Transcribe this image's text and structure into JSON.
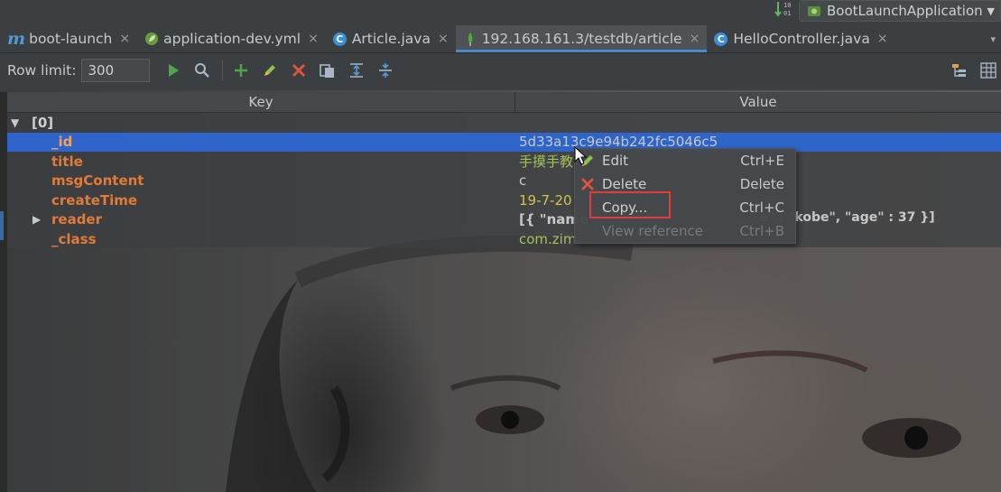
{
  "run_config": {
    "label": "BootLaunchApplication",
    "caret": "▼",
    "sort_badge": "10\n01"
  },
  "tabs": [
    {
      "label": "boot-launch",
      "icon": "maven-m-icon",
      "glyph": "m",
      "close": "×"
    },
    {
      "label": "application-dev.yml",
      "icon": "spring-leaf-icon",
      "close": "×"
    },
    {
      "label": "Article.java",
      "icon": "class-c-icon",
      "glyph": "C",
      "close": "×"
    },
    {
      "label": "192.168.161.3/testdb/article",
      "icon": "mongo-leaf-icon",
      "close": "×",
      "active": true
    },
    {
      "label": "HelloController.java",
      "icon": "class-c-icon",
      "glyph": "C",
      "close": "×"
    }
  ],
  "tab_overflow": "▾",
  "toolbar": {
    "row_limit_label": "Row limit:",
    "row_limit_value": "300",
    "buttons": [
      "run-icon",
      "find-icon",
      "add-icon",
      "edit-icon",
      "delete-icon",
      "copy-icon",
      "expand-all-icon",
      "collapse-all-icon"
    ],
    "right_buttons": [
      "tree-view-icon",
      "table-view-icon"
    ]
  },
  "table": {
    "headers": {
      "key": "Key",
      "value": "Value"
    },
    "root": {
      "expander": "▼",
      "label": "[0]"
    },
    "rows": [
      {
        "key": "_id",
        "value": "5d33a13c9e94b242fc5046c5",
        "type": "plain",
        "selected": true
      },
      {
        "key": "title",
        "value": "手摸手教",
        "type": "str"
      },
      {
        "key": "msgContent",
        "value": "c",
        "type": "plain"
      },
      {
        "key": "createTime",
        "value": "19-7-20",
        "type": "num"
      },
      {
        "key": "reader",
        "value": "[{ \"name",
        "type": "plain",
        "expander": "▶",
        "bold": true
      },
      {
        "key": "_class",
        "value": "com.zim",
        "type": "str"
      }
    ],
    "reader_tail": "e\" : \"kobe\", \"age\" : 37 }]"
  },
  "context_menu": {
    "items": [
      {
        "label": "Edit",
        "shortcut": "Ctrl+E",
        "icon": "pencil-icon",
        "enabled": true
      },
      {
        "label": "Delete",
        "shortcut": "Delete",
        "icon": "red-x-icon",
        "enabled": true
      },
      {
        "label": "Copy...",
        "shortcut": "Ctrl+C",
        "icon": "",
        "enabled": true,
        "highlighted": true
      },
      {
        "label": "View reference",
        "shortcut": "Ctrl+B",
        "icon": "",
        "enabled": false
      }
    ]
  },
  "colors": {
    "selection": "#2f65ca",
    "key_orange": "#e07b39",
    "string_green": "#a5c25c",
    "highlight_red": "#e23b3b",
    "active_tab_underline": "#4a88c7"
  }
}
